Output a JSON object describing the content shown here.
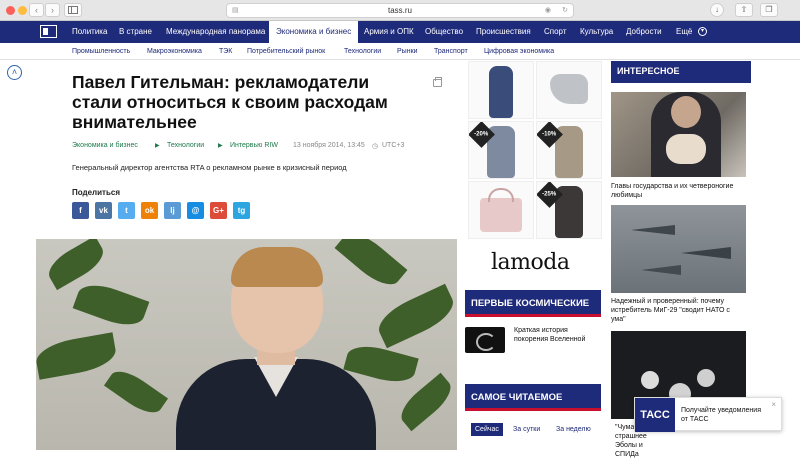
{
  "browser": {
    "url": "tass.ru",
    "back_label": "‹",
    "forward_label": "›",
    "sidebar_icon": "sidebar-icon",
    "reader_icon": "reader-icon",
    "audio_icon": "audio-icon",
    "reload_icon": "reload-icon",
    "download_icon": "download-icon",
    "share_icon": "share-icon",
    "tabs_icon": "tabs-icon"
  },
  "topnav": {
    "items": [
      "Политика",
      "В стране",
      "Международная панорама",
      "Экономика и бизнес",
      "Армия и ОПК",
      "Общество",
      "Происшествия",
      "Спорт",
      "Культура",
      "Доброcти",
      "Ещё"
    ],
    "active_index": 3,
    "active_bg": "#ffffff",
    "brand_color": "#1e2a7a"
  },
  "subnav": {
    "items": [
      "Промышленность",
      "Макроэкономика",
      "ТЭК",
      "Потребительский рынок",
      "Технологии",
      "Рынки",
      "Транспорт",
      "Цифровая экономика"
    ]
  },
  "article": {
    "title": "Павел Гительман: рекламодатели стали относиться к своим расходам внимательнее",
    "breadcrumbs": [
      "Экономика и бизнес",
      "Технологии",
      "Интервью RIW"
    ],
    "date": "13 ноября 2014, 13:45",
    "timezone": "UTC+3",
    "lead": "Генеральный директор агентства RTA о рекламном рынке в кризисный период",
    "share_label": "Поделиться",
    "share_buttons": [
      {
        "label": "f",
        "icon": "facebook-icon",
        "color": "#3b5998"
      },
      {
        "label": "vk",
        "icon": "vk-icon",
        "color": "#4c75a3"
      },
      {
        "label": "t",
        "icon": "twitter-icon",
        "color": "#55acee"
      },
      {
        "label": "ok",
        "icon": "odnoklassniki-icon",
        "color": "#ee8208"
      },
      {
        "label": "lj",
        "icon": "livejournal-icon",
        "color": "#5a9bd5"
      },
      {
        "label": "@",
        "icon": "mail-icon",
        "color": "#168de2"
      },
      {
        "label": "G+",
        "icon": "google-plus-icon",
        "color": "#dd4b39"
      },
      {
        "label": "tg",
        "icon": "telegram-icon",
        "color": "#2ca5e0"
      }
    ]
  },
  "shop": {
    "badges": [
      "-20%",
      "-10%",
      "-25%"
    ],
    "brand": "lamoda"
  },
  "space_panel": {
    "title": "ПЕРВЫЕ КОСМИЧЕСКИЕ",
    "item_text": "Краткая история покорения Вселенной"
  },
  "popular_panel": {
    "title": "САМОЕ ЧИТАЕМОЕ",
    "tabs": [
      "Сейчас",
      "За сутки",
      "За неделю"
    ],
    "active_tab": 0
  },
  "interesting": {
    "title": "ИНТЕРЕСНОЕ",
    "items": [
      "Главы государства и их четвероногие любимцы",
      "Надежный и проверенный: почему истребитель МиГ-29 \"сводит НАТО с ума\"",
      "\"Чума\" страшнее Эболы и СПИДа"
    ]
  },
  "notification": {
    "logo": "ТАСС",
    "text": "Получайте уведомления от ТАСС",
    "close": "×"
  }
}
